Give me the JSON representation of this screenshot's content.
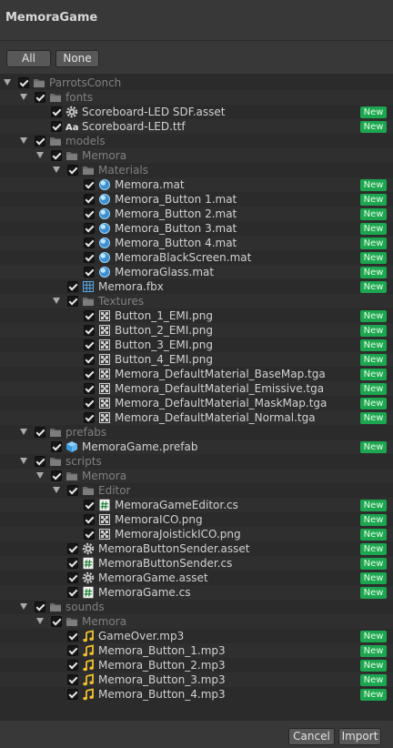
{
  "window": {
    "title": "MemoraGame"
  },
  "filters": {
    "all_label": "All",
    "none_label": "None"
  },
  "footer": {
    "cancel_label": "Cancel",
    "import_label": "Import"
  },
  "badge_label": "New",
  "items": [
    {
      "label": "ParrotsConch",
      "depth": 0,
      "type": "folder",
      "expanded": true,
      "is_new": false
    },
    {
      "label": "fonts",
      "depth": 1,
      "type": "folder",
      "expanded": true,
      "is_new": false
    },
    {
      "label": "Scoreboard-LED SDF.asset",
      "depth": 2,
      "type": "asset",
      "is_new": true
    },
    {
      "label": "Scoreboard-LED.ttf",
      "depth": 2,
      "type": "font",
      "is_new": true
    },
    {
      "label": "models",
      "depth": 1,
      "type": "folder",
      "expanded": true,
      "is_new": false
    },
    {
      "label": "Memora",
      "depth": 2,
      "type": "folder",
      "expanded": true,
      "is_new": false
    },
    {
      "label": "Materials",
      "depth": 3,
      "type": "folder",
      "expanded": true,
      "is_new": false
    },
    {
      "label": "Memora.mat",
      "depth": 4,
      "type": "material",
      "is_new": true
    },
    {
      "label": "Memora_Button 1.mat",
      "depth": 4,
      "type": "material",
      "is_new": true
    },
    {
      "label": "Memora_Button 2.mat",
      "depth": 4,
      "type": "material",
      "is_new": true
    },
    {
      "label": "Memora_Button 3.mat",
      "depth": 4,
      "type": "material",
      "is_new": true
    },
    {
      "label": "Memora_Button 4.mat",
      "depth": 4,
      "type": "material",
      "is_new": true
    },
    {
      "label": "MemoraBlackScreen.mat",
      "depth": 4,
      "type": "material",
      "is_new": true
    },
    {
      "label": "MemoraGlass.mat",
      "depth": 4,
      "type": "material",
      "is_new": true
    },
    {
      "label": "Memora.fbx",
      "depth": 3,
      "type": "mesh",
      "is_new": true
    },
    {
      "label": "Textures",
      "depth": 3,
      "type": "folder",
      "expanded": true,
      "is_new": false
    },
    {
      "label": "Button_1_EMI.png",
      "depth": 4,
      "type": "texture",
      "is_new": true
    },
    {
      "label": "Button_2_EMI.png",
      "depth": 4,
      "type": "texture",
      "is_new": true
    },
    {
      "label": "Button_3_EMI.png",
      "depth": 4,
      "type": "texture",
      "is_new": true
    },
    {
      "label": "Button_4_EMI.png",
      "depth": 4,
      "type": "texture",
      "is_new": true
    },
    {
      "label": "Memora_DefaultMaterial_BaseMap.tga",
      "depth": 4,
      "type": "texture",
      "is_new": true
    },
    {
      "label": "Memora_DefaultMaterial_Emissive.tga",
      "depth": 4,
      "type": "texture",
      "is_new": true
    },
    {
      "label": "Memora_DefaultMaterial_MaskMap.tga",
      "depth": 4,
      "type": "texture",
      "is_new": true
    },
    {
      "label": "Memora_DefaultMaterial_Normal.tga",
      "depth": 4,
      "type": "texture",
      "is_new": true
    },
    {
      "label": "prefabs",
      "depth": 1,
      "type": "folder",
      "expanded": true,
      "is_new": false
    },
    {
      "label": "MemoraGame.prefab",
      "depth": 2,
      "type": "prefab",
      "is_new": true
    },
    {
      "label": "scripts",
      "depth": 1,
      "type": "folder",
      "expanded": true,
      "is_new": false
    },
    {
      "label": "Memora",
      "depth": 2,
      "type": "folder",
      "expanded": true,
      "is_new": false
    },
    {
      "label": "Editor",
      "depth": 3,
      "type": "folder",
      "expanded": true,
      "is_new": false
    },
    {
      "label": "MemoraGameEditor.cs",
      "depth": 4,
      "type": "script",
      "is_new": true
    },
    {
      "label": "MemoraICO.png",
      "depth": 4,
      "type": "texture",
      "is_new": true
    },
    {
      "label": "MemoraJoistickICO.png",
      "depth": 4,
      "type": "texture",
      "is_new": true
    },
    {
      "label": "MemoraButtonSender.asset",
      "depth": 3,
      "type": "asset",
      "is_new": true
    },
    {
      "label": "MemoraButtonSender.cs",
      "depth": 3,
      "type": "script",
      "is_new": true
    },
    {
      "label": "MemoraGame.asset",
      "depth": 3,
      "type": "asset",
      "is_new": true
    },
    {
      "label": "MemoraGame.cs",
      "depth": 3,
      "type": "script",
      "is_new": true
    },
    {
      "label": "sounds",
      "depth": 1,
      "type": "folder",
      "expanded": true,
      "is_new": false
    },
    {
      "label": "Memora",
      "depth": 2,
      "type": "folder",
      "expanded": true,
      "is_new": false
    },
    {
      "label": "GameOver.mp3",
      "depth": 3,
      "type": "audio",
      "is_new": true
    },
    {
      "label": "Memora_Button_1.mp3",
      "depth": 3,
      "type": "audio",
      "is_new": true
    },
    {
      "label": "Memora_Button_2.mp3",
      "depth": 3,
      "type": "audio",
      "is_new": true
    },
    {
      "label": "Memora_Button_3.mp3",
      "depth": 3,
      "type": "audio",
      "is_new": true
    },
    {
      "label": "Memora_Button_4.mp3",
      "depth": 3,
      "type": "audio",
      "is_new": true
    }
  ],
  "icons": {
    "folder": "folder-icon",
    "asset": "gear-icon",
    "font": "font-icon",
    "material": "material-sphere-icon",
    "mesh": "mesh-grid-icon",
    "texture": "texture-icon",
    "prefab": "prefab-cube-icon",
    "script": "script-hash-icon",
    "audio": "music-note-icon"
  },
  "colors": {
    "background": "#383838",
    "list_background": "#2b2b2b",
    "new_badge": "#1da650",
    "text": "#d2d2d2",
    "dim_text": "#808080"
  }
}
